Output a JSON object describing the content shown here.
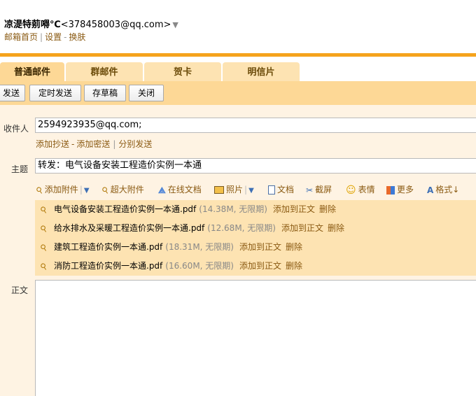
{
  "header": {
    "nickname": "凉湜特莂嘚℃",
    "email": "<378458003@qq.com>",
    "caret": "▼",
    "links": [
      "邮箱首页",
      "设置",
      "换肤"
    ]
  },
  "tabs": [
    "普通邮件",
    "群邮件",
    "贺卡",
    "明信片"
  ],
  "toolbar": {
    "send": "发送",
    "scheduled_send": "定时发送",
    "save_draft": "存草稿",
    "close": "关闭"
  },
  "compose": {
    "to_label": "收件人",
    "to_value": "2594923935@qq.com;",
    "cc_link": "添加抄送",
    "bcc_link": "添加密送",
    "separate_link": "分别发送",
    "subject_label": "主题",
    "subject_value": "转发：电气设备安装工程造价实例一本通",
    "body_label": "正文"
  },
  "attach_toolbar": {
    "add_attachment": "添加附件",
    "large_attachment": "超大附件",
    "online_docs": "在线文档",
    "photos": "照片",
    "docs": "文档",
    "screenshot": "截屏",
    "emoji": "表情",
    "more": "更多",
    "format": "格式↓"
  },
  "attachments": [
    {
      "name": "电气设备安装工程造价实例一本通.pdf",
      "meta": "(14.38M, 无限期)",
      "add": "添加到正文",
      "del": "删除"
    },
    {
      "name": "给水排水及采暖工程造价实例一本通.pdf",
      "meta": "(12.68M, 无限期)",
      "add": "添加到正文",
      "del": "删除"
    },
    {
      "name": "建筑工程造价实例一本通.pdf",
      "meta": "(18.31M, 无限期)",
      "add": "添加到正文",
      "del": "删除"
    },
    {
      "name": "消防工程造价实例一本通.pdf",
      "meta": "(16.60M, 无限期)",
      "add": "添加到正文",
      "del": "删除"
    }
  ],
  "colors": {
    "accent_orange": "#f5a31c",
    "tab_active": "#fdd896",
    "link_brown": "#8a5a12",
    "compose_bg": "#fef3e3"
  }
}
